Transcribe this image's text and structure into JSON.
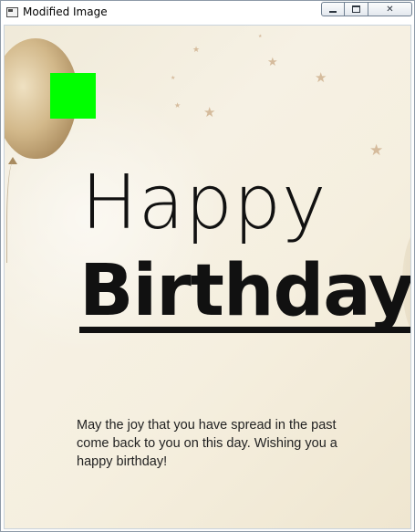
{
  "window": {
    "title": "Modified Image",
    "icon": "app-window-icon",
    "controls": {
      "minimize_icon": "minimize-icon",
      "maximize_icon": "maximize-icon",
      "close_label": "✕"
    }
  },
  "card": {
    "heading_line1": "Happy",
    "heading_line2": "Birthday",
    "message": "May the joy that you have spread in the past come back to you on this day. Wishing you a happy birthday!",
    "colors": {
      "background": "#f5efdf",
      "text": "#111111",
      "balloon": "#d2b88a",
      "stars": "#d5bb9c",
      "overlay_square": "#00ff00"
    }
  }
}
